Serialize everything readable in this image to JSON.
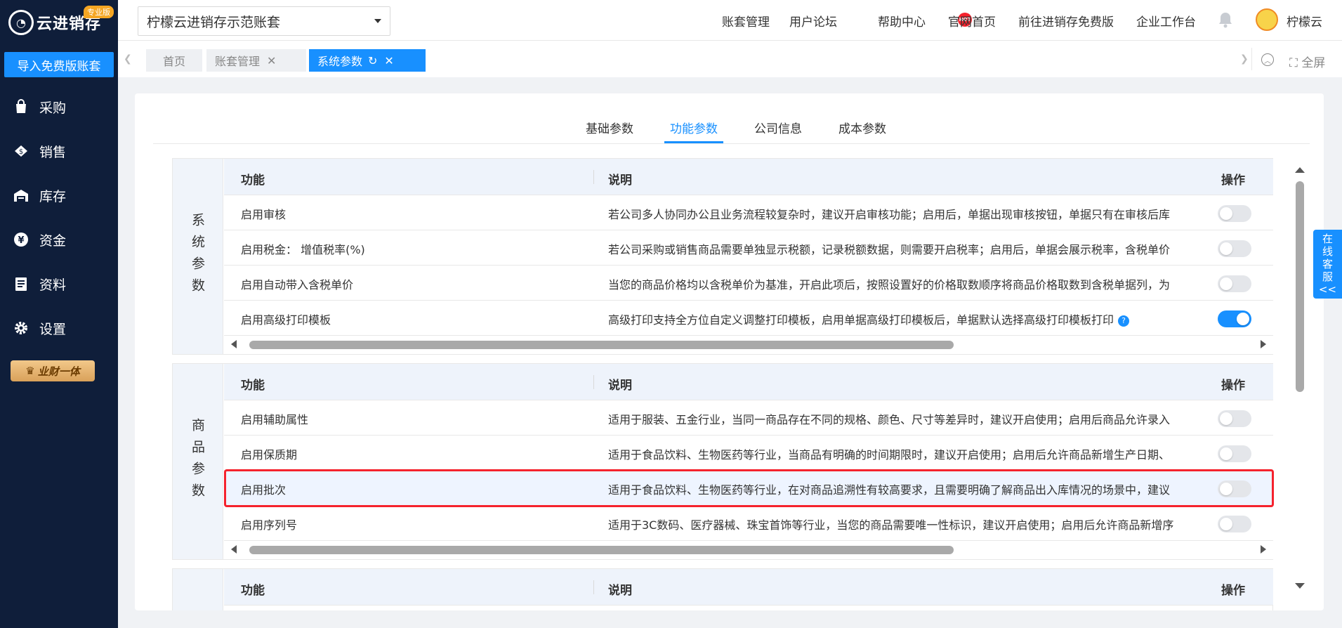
{
  "sidebar": {
    "logo_text": "云进销存",
    "logo_badge": "专业版",
    "import_button": "导入免费版账套",
    "items": [
      {
        "label": "采购",
        "icon": "bag-icon"
      },
      {
        "label": "销售",
        "icon": "sales-icon"
      },
      {
        "label": "库存",
        "icon": "warehouse-icon"
      },
      {
        "label": "资金",
        "icon": "yen-icon"
      },
      {
        "label": "资料",
        "icon": "document-icon"
      },
      {
        "label": "设置",
        "icon": "gear-icon"
      }
    ],
    "promo": "业财一体"
  },
  "header": {
    "account": "柠檬云进销存示范账套",
    "links": [
      "账套管理",
      "用户论坛",
      "帮助中心",
      "官网首页",
      "前往进销存免费版",
      "企业工作台"
    ],
    "hot_badge": "HOT",
    "user_name": "柠檬云"
  },
  "page_tabs": {
    "tabs": [
      {
        "label": "首页"
      },
      {
        "label": "账套管理"
      },
      {
        "label": "系统参数"
      }
    ],
    "fullscreen": "全屏"
  },
  "param_tabs": [
    "基础参数",
    "功能参数",
    "公司信息",
    "成本参数"
  ],
  "table_headers": {
    "fn": "功能",
    "desc": "说明",
    "op": "操作"
  },
  "groups": [
    {
      "label": "系统参数",
      "rows": [
        {
          "fn": "启用审核",
          "desc": "若公司多人协同办公且业务流程较复杂时，建议开启审核功能；启用后，单据出现审核按钮，单据只有在审核后库",
          "on": false
        },
        {
          "fn": "启用税金： 增值税率(%)",
          "desc": "若公司采购或销售商品需要单独显示税额，记录税额数据，则需要开启税率；启用后，单据会展示税率，含税单价",
          "on": false
        },
        {
          "fn": "启用自动带入含税单价",
          "desc": "当您的商品价格均以含税单价为基准，开启此项后，按照设置好的价格取数顺序将商品价格取数到含税单据列，为",
          "on": false
        },
        {
          "fn": "启用高级打印模板",
          "desc": "高级打印支持全方位自定义调整打印模板，启用单据高级打印模板后，单据默认选择高级打印模板打印",
          "on": true
        }
      ]
    },
    {
      "label": "商品参数",
      "rows": [
        {
          "fn": "启用辅助属性",
          "desc": "适用于服装、五金行业，当同一商品存在不同的规格、颜色、尺寸等差异时，建议开启使用；启用后商品允许录入",
          "on": false
        },
        {
          "fn": "启用保质期",
          "desc": "适用于食品饮料、生物医药等行业，当商品有明确的时间期限时，建议开启使用；启用后允许商品新增生产日期、",
          "on": false
        },
        {
          "fn": "启用批次",
          "desc": "适用于食品饮料、生物医药等行业，在对商品追溯性有较高要求，且需要明确了解商品出入库情况的场景中，建议",
          "on": false
        },
        {
          "fn": "启用序列号",
          "desc": "适用于3C数码、医疗器械、珠宝首饰等行业，当您的商品需要唯一性标识，建议开启使用；启用后允许商品新增序",
          "on": false
        }
      ]
    }
  ],
  "service": [
    "在",
    "线",
    "客",
    "服",
    "<<"
  ]
}
